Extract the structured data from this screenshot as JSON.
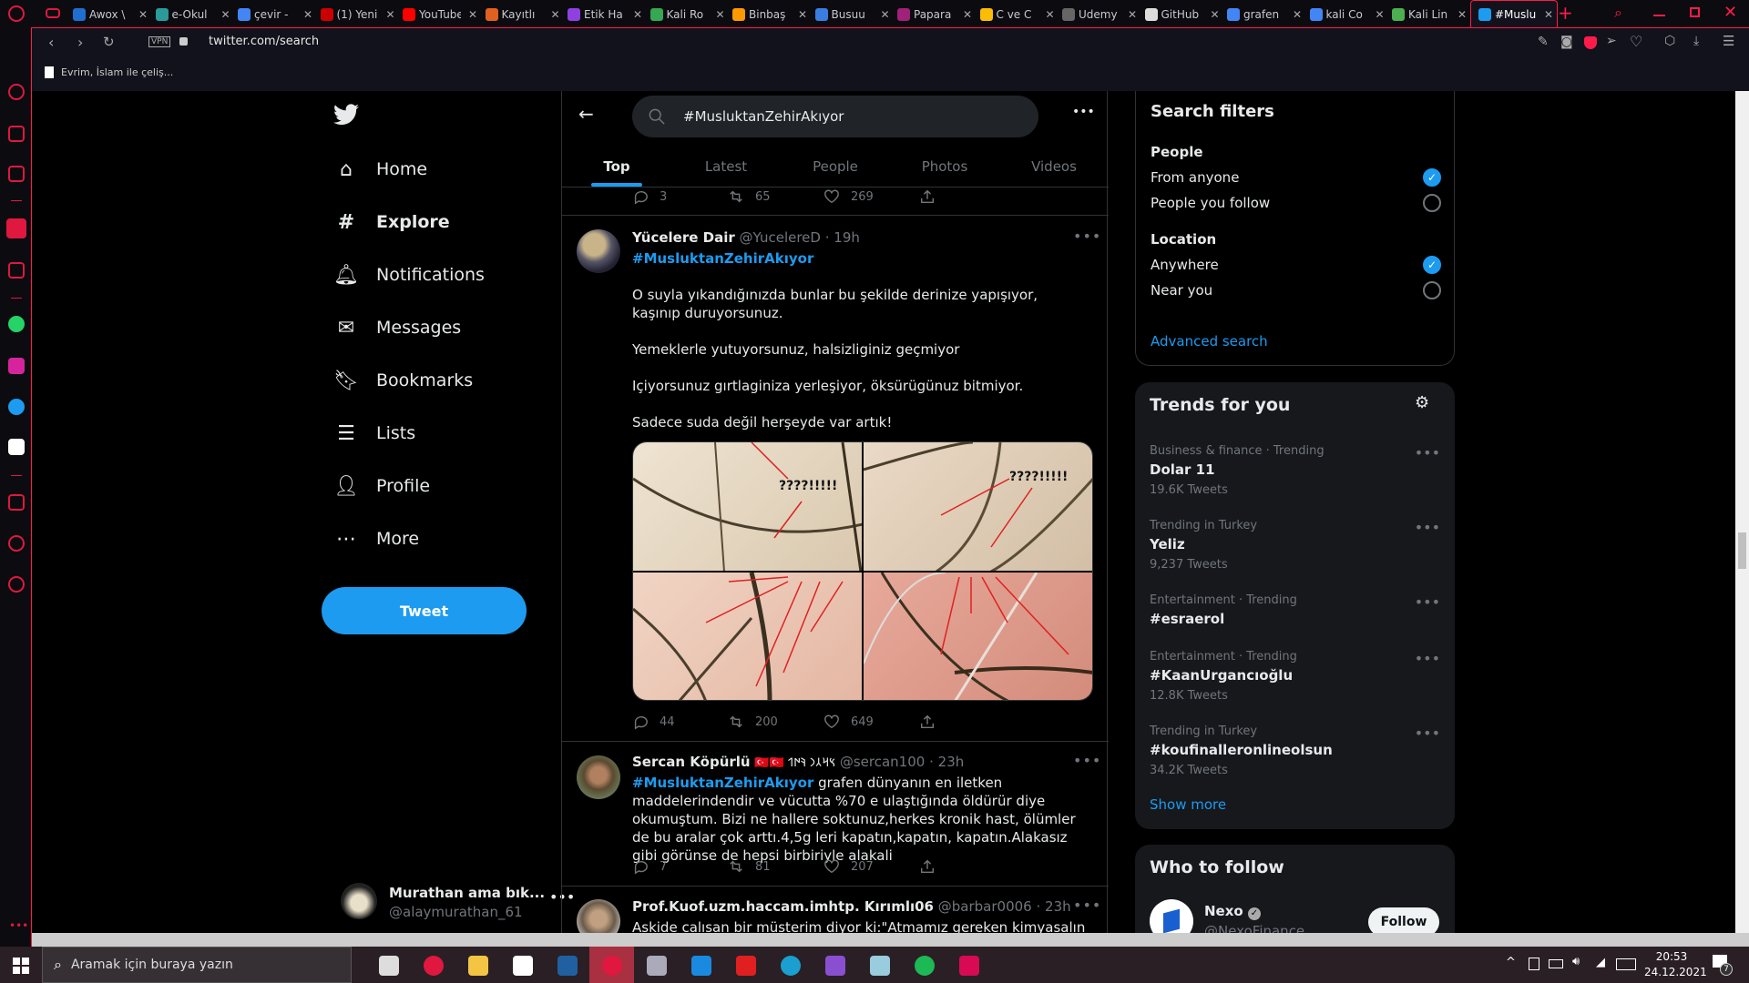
{
  "browser": {
    "tabs": [
      {
        "label": "Awox \\",
        "color": "#1e6fd0"
      },
      {
        "label": "e-Okul",
        "color": "#2a9a9a"
      },
      {
        "label": "çevir -",
        "color": "#4285f4"
      },
      {
        "label": "(1) Yeni",
        "color": "#c00"
      },
      {
        "label": "YouTube",
        "color": "#f00"
      },
      {
        "label": "Kayıtlı",
        "color": "#e06020"
      },
      {
        "label": "Etik Ha",
        "color": "#9040e0"
      },
      {
        "label": "Kali Ro",
        "color": "#34a853"
      },
      {
        "label": "Binbaş",
        "color": "#f90"
      },
      {
        "label": "Busuu",
        "color": "#3a7de0"
      },
      {
        "label": "Papara",
        "color": "#a0207a"
      },
      {
        "label": "C ve C",
        "color": "#fbbc04"
      },
      {
        "label": "Udemy",
        "color": "#666"
      },
      {
        "label": "GitHub",
        "color": "#ddd"
      },
      {
        "label": "grafen",
        "color": "#4285f4"
      },
      {
        "label": "kali Co",
        "color": "#4285f4"
      },
      {
        "label": "Kali Lin",
        "color": "#4caf50"
      },
      {
        "label": "#Muslu",
        "color": "#1d9bf0",
        "active": true
      }
    ],
    "vpn_label": "VPN",
    "url": "twitter.com/search",
    "bookmark": "Evrim, İslam ile çeliş...",
    "accent": "#ff1b4a"
  },
  "nav": {
    "items": [
      {
        "label": "Home",
        "icon": "home-icon"
      },
      {
        "label": "Explore",
        "icon": "hashtag-icon",
        "active": true
      },
      {
        "label": "Notifications",
        "icon": "bell-icon"
      },
      {
        "label": "Messages",
        "icon": "envelope-icon"
      },
      {
        "label": "Bookmarks",
        "icon": "bookmark-icon"
      },
      {
        "label": "Lists",
        "icon": "list-icon"
      },
      {
        "label": "Profile",
        "icon": "person-icon"
      },
      {
        "label": "More",
        "icon": "more-circle-icon"
      }
    ],
    "tweet_button": "Tweet",
    "account": {
      "name": "Murathan ama bık...",
      "handle": "@alaymurathan_61"
    }
  },
  "search": {
    "query": "#MusluktanZehirAkıyor",
    "tabs": [
      "Top",
      "Latest",
      "People",
      "Photos",
      "Videos"
    ],
    "active_tab": "Top"
  },
  "tweets": [
    {
      "replies": "3",
      "retweets": "65",
      "likes": "269"
    },
    {
      "name": "Yücelere Dair",
      "handle": "@YucelereD",
      "time": "19h",
      "hashtag": "#MusluktanZehirAkıyor",
      "paragraphs": [
        "O suyla yıkandığınızda bunlar bu şekilde derinize yapışıyor, kaşınıp duruyorsunuz.",
        "Yemeklerle yutuyorsunuz, halsizliginiz geçmiyor",
        "Içiyorsunuz gırtlaginiza yerleşiyor, öksürügünuz bitmiyor.",
        "Sadece suda değil herşeyde var artık!"
      ],
      "image_captions": [
        "????!!!!!",
        "????!!!!!"
      ],
      "replies": "44",
      "retweets": "200",
      "likes": "649"
    },
    {
      "name": "Sercan Köpürlü",
      "badges": "🇹🇷🇹🇷 𐰽𐰺𐰲𐰣 𐰚𐰇𐰯",
      "handle": "@sercan100",
      "time": "23h",
      "hashtag": "#MusluktanZehirAkıyor",
      "text": "grafen dünyanın en iletken maddelerindendir ve vücutta %70 e ulaştığında öldürür diye okumuştum. Bizi ne hallere soktunuz,herkes kronik hast, ölümler de bu aralar çok arttı.4,5g leri kapatın,kapatın, kapatın.Alakasız gibi görünse de hepsi birbiriyle alakali",
      "replies": "7",
      "retweets": "81",
      "likes": "207"
    },
    {
      "name": "Prof.Kuof.uzm.haccam.imhtp. Kırımlı06",
      "handle": "@barbar0006",
      "time": "23h",
      "text": "Askide calısan bir müsterim diyor ki:\"Atmamız gereken kimyasalın iki katını"
    }
  ],
  "filters": {
    "title": "Search filters",
    "people_label": "People",
    "people": [
      {
        "label": "From anyone",
        "checked": true
      },
      {
        "label": "People you follow",
        "checked": false
      }
    ],
    "location_label": "Location",
    "location": [
      {
        "label": "Anywhere",
        "checked": true
      },
      {
        "label": "Near you",
        "checked": false
      }
    ],
    "advanced": "Advanced search"
  },
  "trends": {
    "title": "Trends for you",
    "items": [
      {
        "category": "Business & finance · Trending",
        "name": "Dolar 11",
        "count": "19.6K Tweets"
      },
      {
        "category": "Trending in Turkey",
        "name": "Yeliz",
        "count": "9,237 Tweets"
      },
      {
        "category": "Entertainment · Trending",
        "name": "#esraerol",
        "count": ""
      },
      {
        "category": "Entertainment · Trending",
        "name": "#KaanUrgancıoğlu",
        "count": "12.8K Tweets"
      },
      {
        "category": "Trending in Turkey",
        "name": "#koufinalleronlineolsun",
        "count": "34.2K Tweets"
      }
    ],
    "show_more": "Show more"
  },
  "who_to_follow": {
    "title": "Who to follow",
    "users": [
      {
        "name": "Nexo",
        "handle": "@NexoFinance",
        "verified": true,
        "button": "Follow"
      }
    ]
  },
  "taskbar": {
    "search_placeholder": "Aramak için buraya yazın",
    "apps": [
      "task-view",
      "opera",
      "file-explorer",
      "store",
      "virtualbox",
      "opera-active",
      "task-manager",
      "mail",
      "roblox",
      "edge",
      "visual-studio",
      "notepad",
      "spotify",
      "debian"
    ],
    "time": "20:53",
    "date": "24.12.2021",
    "notifications": "7"
  }
}
